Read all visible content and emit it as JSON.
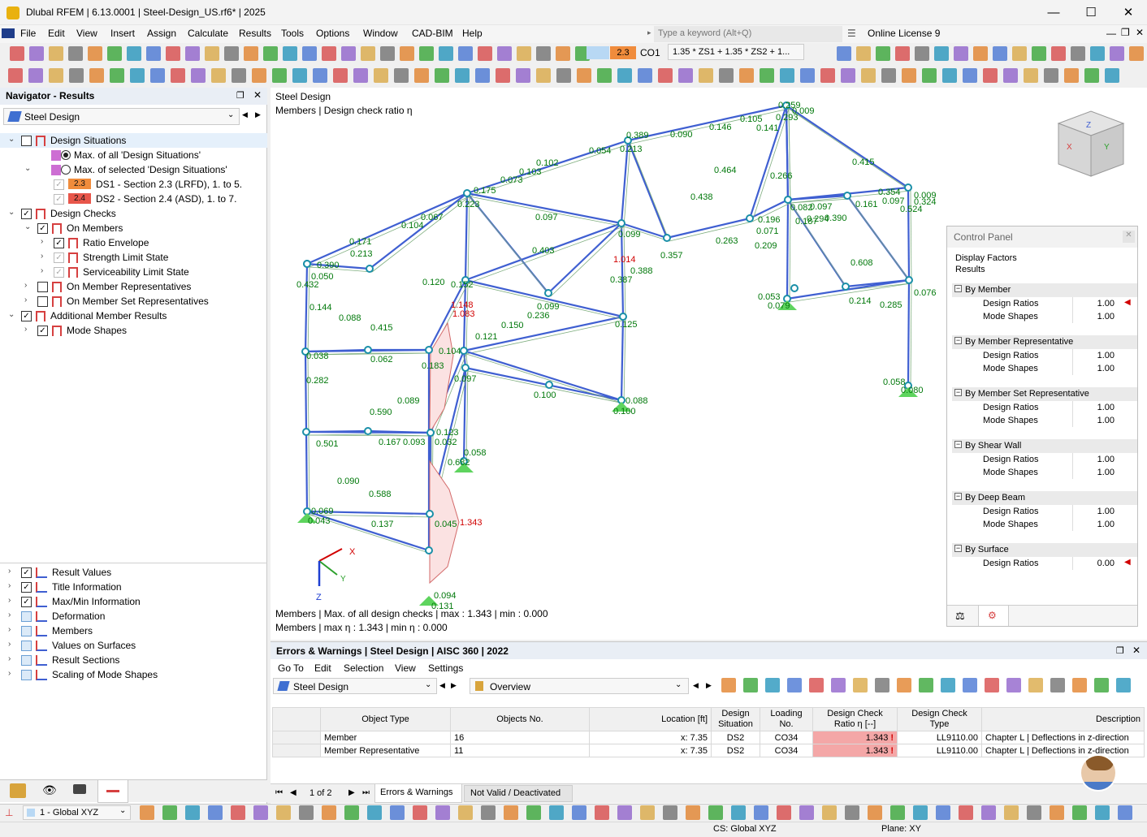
{
  "window": {
    "title": "Dlubal RFEM | 6.13.0001 | Steel-Design_US.rf6* | 2025",
    "minimize": "—",
    "maximize": "☐",
    "close": "✕"
  },
  "menu": {
    "items": [
      "File",
      "Edit",
      "View",
      "Insert",
      "Assign",
      "Calculate",
      "Results",
      "Tools",
      "Options",
      "Window",
      "CAD-BIM",
      "Help"
    ],
    "search_placeholder": "Type a keyword (Alt+Q)",
    "license": "Online License 9"
  },
  "toolbar": {
    "ds_badge": "2.3",
    "ds_color": "#f08c3c",
    "loading": "CO1",
    "combination": "1.35 * ZS1 + 1.35 * ZS2 + 1..."
  },
  "navigator": {
    "title": "Navigator - Results",
    "module": "Steel Design",
    "tree": [
      {
        "label": "Design Situations",
        "type": "cb",
        "checked": false,
        "level": 0,
        "exp": "v",
        "selected": true
      },
      {
        "label": "Max. of all 'Design Situations'",
        "type": "radio",
        "checked": true,
        "level": 1
      },
      {
        "label": "Max. of selected 'Design Situations'",
        "type": "radio",
        "checked": false,
        "level": 1,
        "exp": "v"
      },
      {
        "label": "DS1 - Section 2.3 (LRFD), 1. to 5.",
        "type": "cbdis",
        "checked": true,
        "level": 2,
        "badge": "2.3",
        "badge_color": "#f08c3c"
      },
      {
        "label": "DS2 - Section 2.4 (ASD), 1. to 7.",
        "type": "cbdis",
        "checked": true,
        "level": 2,
        "badge": "2.4",
        "badge_color": "#e8564a"
      },
      {
        "label": "Design Checks",
        "type": "cb",
        "checked": true,
        "level": 0,
        "exp": "v"
      },
      {
        "label": "On Members",
        "type": "cb",
        "checked": true,
        "level": 1,
        "exp": "v"
      },
      {
        "label": "Ratio Envelope",
        "type": "cb",
        "checked": true,
        "level": 2,
        "exp": ">"
      },
      {
        "label": "Strength Limit State",
        "type": "cbdis",
        "checked": true,
        "level": 2,
        "exp": ">"
      },
      {
        "label": "Serviceability Limit State",
        "type": "cbdis",
        "checked": true,
        "level": 2,
        "exp": ">"
      },
      {
        "label": "On Member Representatives",
        "type": "cb",
        "checked": false,
        "level": 1,
        "exp": ">"
      },
      {
        "label": "On Member Set Representatives",
        "type": "cb",
        "checked": false,
        "level": 1,
        "exp": ">"
      },
      {
        "label": "Additional Member Results",
        "type": "cb",
        "checked": true,
        "level": 0,
        "exp": "v"
      },
      {
        "label": "Mode Shapes",
        "type": "cb",
        "checked": true,
        "level": 1,
        "exp": ">"
      }
    ],
    "bottom_tree": [
      {
        "label": "Result Values",
        "checked": true
      },
      {
        "label": "Title Information",
        "checked": true
      },
      {
        "label": "Max/Min Information",
        "checked": true
      },
      {
        "label": "Deformation",
        "checked": false
      },
      {
        "label": "Members",
        "checked": false
      },
      {
        "label": "Values on Surfaces",
        "checked": false
      },
      {
        "label": "Result Sections",
        "checked": false
      },
      {
        "label": "Scaling of Mode Shapes",
        "checked": false
      }
    ]
  },
  "view": {
    "title1": "Steel Design",
    "title2": "Members | Design check ratio η",
    "info1": "Members | Max. of all design checks | max  : 1.343 | min  : 0.000",
    "info2": "Members | max η : 1.343 | min η : 0.000",
    "axes": {
      "x": "X",
      "y": "Y",
      "z": "Z"
    },
    "labels": [
      {
        "t": "0.259",
        "c": "g"
      },
      {
        "t": "0.009",
        "c": "g"
      },
      {
        "t": "0.293",
        "c": "g"
      },
      {
        "t": "0.141",
        "c": "g"
      },
      {
        "t": "0.105",
        "c": "g"
      },
      {
        "t": "0.146",
        "c": "g"
      },
      {
        "t": "0.090",
        "c": "g"
      },
      {
        "t": "0.389",
        "c": "g"
      },
      {
        "t": "0.213",
        "c": "g"
      },
      {
        "t": "0.054",
        "c": "g"
      },
      {
        "t": "0.102",
        "c": "g"
      },
      {
        "t": "0.103",
        "c": "g"
      },
      {
        "t": "0.073",
        "c": "g"
      },
      {
        "t": "0.175",
        "c": "g"
      },
      {
        "t": "0.223",
        "c": "g"
      },
      {
        "t": "0.067",
        "c": "g"
      },
      {
        "t": "0.104",
        "c": "g"
      },
      {
        "t": "0.171",
        "c": "g"
      },
      {
        "t": "0.213",
        "c": "g"
      },
      {
        "t": "0.390",
        "c": "g"
      },
      {
        "t": "0.050",
        "c": "g"
      },
      {
        "t": "0.432",
        "c": "g"
      },
      {
        "t": "0.464",
        "c": "g"
      },
      {
        "t": "0.415",
        "c": "g"
      },
      {
        "t": "0.266",
        "c": "g"
      },
      {
        "t": "0.438",
        "c": "g"
      },
      {
        "t": "0.097",
        "c": "g"
      },
      {
        "t": "0.099",
        "c": "g"
      },
      {
        "t": "0.403",
        "c": "g"
      },
      {
        "t": "0.357",
        "c": "g"
      },
      {
        "t": "0.263",
        "c": "g"
      },
      {
        "t": "0.196",
        "c": "g"
      },
      {
        "t": "0.071",
        "c": "g"
      },
      {
        "t": "0.209",
        "c": "g"
      },
      {
        "t": "0.082",
        "c": "g"
      },
      {
        "t": "0.187",
        "c": "g"
      },
      {
        "t": "0.097",
        "c": "g"
      },
      {
        "t": "0.294",
        "c": "g"
      },
      {
        "t": "0.390",
        "c": "g"
      },
      {
        "t": "0.161",
        "c": "g"
      },
      {
        "t": "0.354",
        "c": "g"
      },
      {
        "t": "0.097",
        "c": "g"
      },
      {
        "t": "0.009",
        "c": "g"
      },
      {
        "t": "0.324",
        "c": "g"
      },
      {
        "t": "0.524",
        "c": "g"
      },
      {
        "t": "0.608",
        "c": "g"
      },
      {
        "t": "0.076",
        "c": "g"
      },
      {
        "t": "0.053",
        "c": "g"
      },
      {
        "t": "0.079",
        "c": "g"
      },
      {
        "t": "0.214",
        "c": "g"
      },
      {
        "t": "0.285",
        "c": "g"
      },
      {
        "t": "0.058",
        "c": "g"
      },
      {
        "t": "0.080",
        "c": "g"
      },
      {
        "t": "1.014",
        "c": "r"
      },
      {
        "t": "0.388",
        "c": "g"
      },
      {
        "t": "0.387",
        "c": "g"
      },
      {
        "t": "0.120",
        "c": "g"
      },
      {
        "t": "0.152",
        "c": "g"
      },
      {
        "t": "1.148",
        "c": "r"
      },
      {
        "t": "1.083",
        "c": "r"
      },
      {
        "t": "0.144",
        "c": "g"
      },
      {
        "t": "0.088",
        "c": "g"
      },
      {
        "t": "0.415",
        "c": "g"
      },
      {
        "t": "0.099",
        "c": "g"
      },
      {
        "t": "0.236",
        "c": "g"
      },
      {
        "t": "0.150",
        "c": "g"
      },
      {
        "t": "0.121",
        "c": "g"
      },
      {
        "t": "0.125",
        "c": "g"
      },
      {
        "t": "0.038",
        "c": "g"
      },
      {
        "t": "0.062",
        "c": "g"
      },
      {
        "t": "0.104",
        "c": "g"
      },
      {
        "t": "0.183",
        "c": "g"
      },
      {
        "t": "0.097",
        "c": "g"
      },
      {
        "t": "0.100",
        "c": "g"
      },
      {
        "t": "0.088",
        "c": "g"
      },
      {
        "t": "0.100",
        "c": "g"
      },
      {
        "t": "0.282",
        "c": "g"
      },
      {
        "t": "0.089",
        "c": "g"
      },
      {
        "t": "0.590",
        "c": "g"
      },
      {
        "t": "0.501",
        "c": "g"
      },
      {
        "t": "0.167",
        "c": "g"
      },
      {
        "t": "0.093",
        "c": "g"
      },
      {
        "t": "0.123",
        "c": "g"
      },
      {
        "t": "0.032",
        "c": "g"
      },
      {
        "t": "0.058",
        "c": "g"
      },
      {
        "t": "0.682",
        "c": "g"
      },
      {
        "t": "0.090",
        "c": "g"
      },
      {
        "t": "0.588",
        "c": "g"
      },
      {
        "t": "0.069",
        "c": "g"
      },
      {
        "t": "0.043",
        "c": "g"
      },
      {
        "t": "0.137",
        "c": "g"
      },
      {
        "t": "0.045",
        "c": "g"
      },
      {
        "t": "1.343",
        "c": "r"
      },
      {
        "t": "0.094",
        "c": "g"
      },
      {
        "t": "0.131",
        "c": "g"
      }
    ]
  },
  "control_panel": {
    "title": "Control Panel",
    "section1": "Display Factors",
    "section2": "Results",
    "groups": [
      {
        "name": "By Member",
        "rows": [
          {
            "label": "Design Ratios",
            "value": "1.00",
            "flag": true
          },
          {
            "label": "Mode Shapes",
            "value": "1.00",
            "flag": false
          }
        ]
      },
      {
        "name": "By Member Representative",
        "rows": [
          {
            "label": "Design Ratios",
            "value": "1.00",
            "flag": false
          },
          {
            "label": "Mode Shapes",
            "value": "1.00",
            "flag": false
          }
        ]
      },
      {
        "name": "By Member Set Representative",
        "rows": [
          {
            "label": "Design Ratios",
            "value": "1.00",
            "flag": false
          },
          {
            "label": "Mode Shapes",
            "value": "1.00",
            "flag": false
          }
        ]
      },
      {
        "name": "By Shear Wall",
        "rows": [
          {
            "label": "Design Ratios",
            "value": "1.00",
            "flag": false
          },
          {
            "label": "Mode Shapes",
            "value": "1.00",
            "flag": false
          }
        ]
      },
      {
        "name": "By Deep Beam",
        "rows": [
          {
            "label": "Design Ratios",
            "value": "1.00",
            "flag": false
          },
          {
            "label": "Mode Shapes",
            "value": "1.00",
            "flag": false
          }
        ]
      },
      {
        "name": "By Surface",
        "rows": [
          {
            "label": "Design Ratios",
            "value": "0.00",
            "flag": true
          }
        ]
      }
    ]
  },
  "errors": {
    "title": "Errors & Warnings | Steel Design | AISC 360 | 2022",
    "menu": [
      "Go To",
      "Edit",
      "Selection",
      "View",
      "Settings"
    ],
    "module": "Steel Design",
    "view_select": "Overview",
    "columns": [
      "Object Type",
      "Objects No.",
      "Location [ft]",
      "Design Situation",
      "Loading No.",
      "Design Check Ratio η [--]",
      "Design Check Type",
      "Description"
    ],
    "rows": [
      {
        "type": "Member",
        "no": "16",
        "loc": "x: 7.35",
        "ds": "DS2",
        "lo": "CO34",
        "ratio": "1.343",
        "check": "LL9110.00",
        "desc": "Chapter L | Deflections in z-direction"
      },
      {
        "type": "Member Representative",
        "no": "11",
        "loc": "x: 7.35",
        "ds": "DS2",
        "lo": "CO34",
        "ratio": "1.343",
        "check": "LL9110.00",
        "desc": "Chapter L | Deflections in z-direction"
      }
    ],
    "pager": "1 of 2",
    "tabs": [
      "Errors & Warnings",
      "Not Valid / Deactivated"
    ]
  },
  "status": {
    "cs": "1 - Global XYZ",
    "cs_text": "CS: Global XYZ",
    "plane": "Plane: XY"
  },
  "colors": {
    "accent_blue": "#3f5fd1",
    "label_green": "#00780a",
    "label_red": "#d10000",
    "ratio_bg": "#f4a7a7",
    "support_green": "#5ed45e"
  }
}
